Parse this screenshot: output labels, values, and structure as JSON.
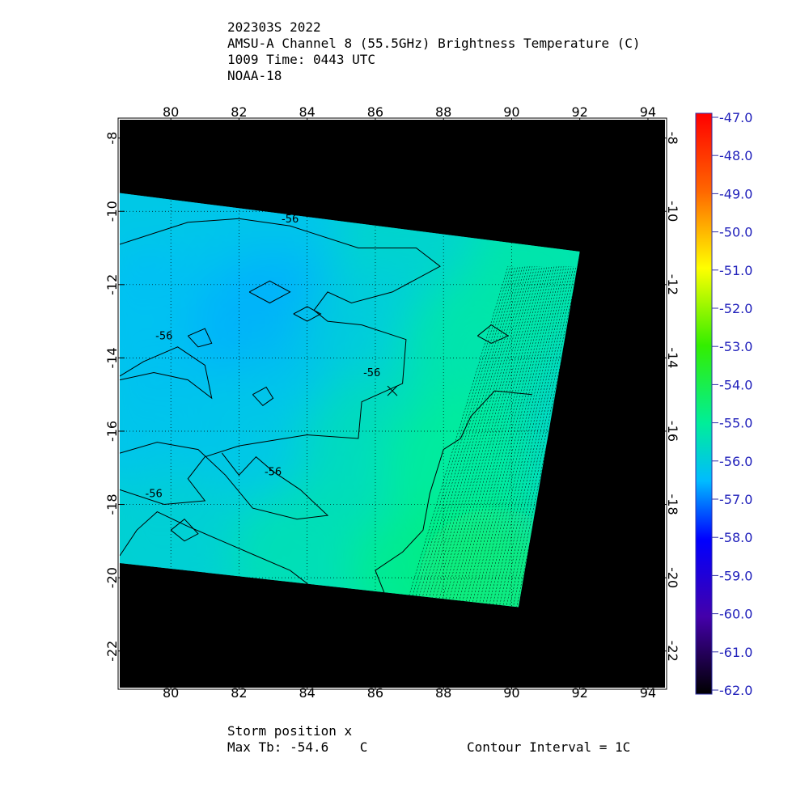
{
  "header": {
    "line1": "202303S 2022",
    "line2": "AMSU-A Channel 8 (55.5GHz) Brightness Temperature (C)",
    "line3": "1009 Time: 0443 UTC",
    "line4": "NOAA-18"
  },
  "footer": {
    "storm_position": "Storm position x",
    "max_tb": "Max Tb: -54.6    C",
    "contour_interval": "Contour Interval = 1C"
  },
  "chart_data": {
    "type": "heatmap",
    "xlim": [
      78.5,
      94.5
    ],
    "ylim": [
      -23,
      -7.5
    ],
    "x_ticks": [
      80,
      82,
      84,
      86,
      88,
      90,
      92,
      94
    ],
    "y_ticks": [
      -8,
      -10,
      -12,
      -14,
      -16,
      -18,
      -20,
      -22
    ],
    "x_tick_labels": [
      "80",
      "82",
      "84",
      "86",
      "88",
      "90",
      "92",
      "94"
    ],
    "y_tick_labels": [
      "-8",
      "-10",
      "-12",
      "-14",
      "-16",
      "-18",
      "-20",
      "-22"
    ],
    "grid": true,
    "background_color": "#000000",
    "swath_polygon": [
      [
        78.5,
        -9.5
      ],
      [
        92.0,
        -11.1
      ],
      [
        90.2,
        -20.8
      ],
      [
        78.5,
        -19.6
      ]
    ],
    "storm_position": [
      86.5,
      -14.9
    ],
    "contour_labels": [
      {
        "text": "-56",
        "x": 83.5,
        "y": -10.3
      },
      {
        "text": "-56",
        "x": 79.8,
        "y": -13.5
      },
      {
        "text": "-56",
        "x": 85.9,
        "y": -14.5
      },
      {
        "text": "-56",
        "x": 83.0,
        "y": -17.2
      },
      {
        "text": "-56",
        "x": 79.5,
        "y": -17.8
      }
    ],
    "colorbar": {
      "min": -62.0,
      "max": -47.0,
      "ticks": [
        -47.0,
        -48.0,
        -49.0,
        -50.0,
        -51.0,
        -52.0,
        -53.0,
        -54.0,
        -55.0,
        -56.0,
        -57.0,
        -58.0,
        -59.0,
        -60.0,
        -61.0,
        -62.0
      ],
      "tick_labels": [
        "-47.0",
        "-48.0",
        "-49.0",
        "-50.0",
        "-51.0",
        "-52.0",
        "-53.0",
        "-54.0",
        "-55.0",
        "-56.0",
        "-57.0",
        "-58.0",
        "-59.0",
        "-60.0",
        "-61.0",
        "-62.0"
      ],
      "stops": [
        {
          "v": -47.0,
          "c": "#ff0000"
        },
        {
          "v": -49.0,
          "c": "#ff6600"
        },
        {
          "v": -51.0,
          "c": "#ffff00"
        },
        {
          "v": -53.0,
          "c": "#33ee00"
        },
        {
          "v": -55.0,
          "c": "#00ee99"
        },
        {
          "v": -56.5,
          "c": "#00bbff"
        },
        {
          "v": -58.0,
          "c": "#0000ff"
        },
        {
          "v": -60.0,
          "c": "#4400aa"
        },
        {
          "v": -62.0,
          "c": "#000000"
        }
      ]
    },
    "field_samples": [
      {
        "x": 79.0,
        "y": -10.0,
        "v": -56.2
      },
      {
        "x": 83.0,
        "y": -10.5,
        "v": -56.3
      },
      {
        "x": 87.0,
        "y": -11.2,
        "v": -55.8
      },
      {
        "x": 91.0,
        "y": -11.5,
        "v": -55.2
      },
      {
        "x": 79.5,
        "y": -13.0,
        "v": -56.4
      },
      {
        "x": 83.0,
        "y": -13.2,
        "v": -56.6
      },
      {
        "x": 86.0,
        "y": -13.5,
        "v": -56.0
      },
      {
        "x": 89.0,
        "y": -13.8,
        "v": -55.2
      },
      {
        "x": 79.5,
        "y": -16.0,
        "v": -56.3
      },
      {
        "x": 83.0,
        "y": -16.0,
        "v": -56.2
      },
      {
        "x": 86.0,
        "y": -16.5,
        "v": -55.5
      },
      {
        "x": 88.5,
        "y": -17.0,
        "v": -55.0
      },
      {
        "x": 80.0,
        "y": -19.0,
        "v": -55.9
      },
      {
        "x": 84.0,
        "y": -19.5,
        "v": -55.4
      },
      {
        "x": 87.5,
        "y": -20.0,
        "v": -54.8
      },
      {
        "x": 89.5,
        "y": -20.2,
        "v": -54.6
      }
    ]
  }
}
